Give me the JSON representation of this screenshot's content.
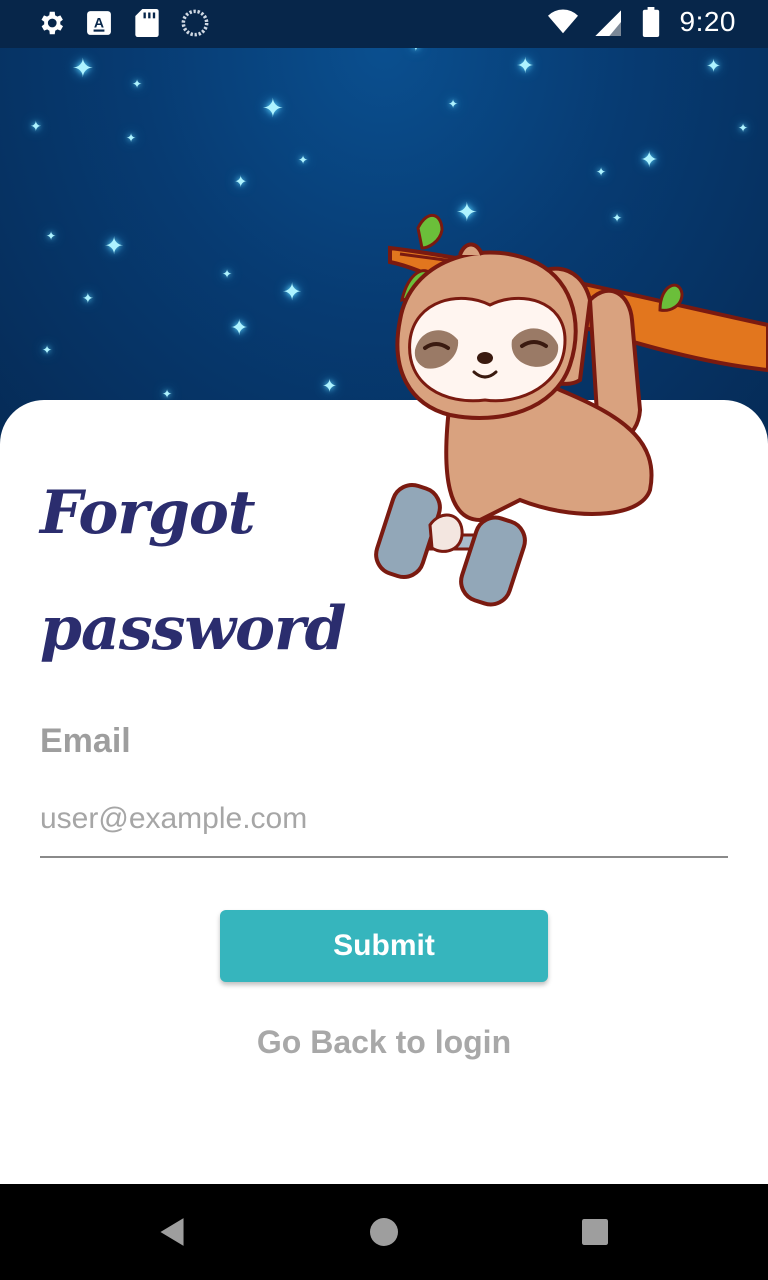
{
  "status_bar": {
    "time": "9:20",
    "left_icons": [
      "gear-icon",
      "a-icon",
      "sd-card-icon",
      "sync-icon"
    ],
    "right_icons": [
      "wifi-icon",
      "signal-icon",
      "battery-icon"
    ]
  },
  "form": {
    "title_line1": "Forgot",
    "title_line2": "password",
    "email_label": "Email",
    "email_placeholder": "user@example.com",
    "email_value": "",
    "submit_label": "Submit",
    "back_link": "Go Back to login"
  },
  "nav_bar": {
    "buttons": [
      "back-icon",
      "home-icon",
      "recents-icon"
    ]
  },
  "colors": {
    "accent": "#36b5bd",
    "title": "#2b2d6e",
    "sky": "#073b72"
  }
}
